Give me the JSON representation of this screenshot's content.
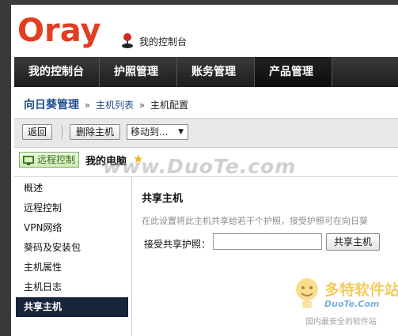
{
  "brand": {
    "logo_text": "Oray",
    "console_link": "我的控制台"
  },
  "nav": {
    "tabs": [
      {
        "label": "我的控制台"
      },
      {
        "label": "护照管理"
      },
      {
        "label": "账务管理"
      },
      {
        "label": "产品管理"
      }
    ],
    "active_index": 3
  },
  "breadcrumb": {
    "root": "向日葵管理",
    "separator": "»",
    "items": [
      "主机列表",
      "主机配置"
    ]
  },
  "toolbar": {
    "back_label": "返回",
    "delete_label": "删除主机",
    "move_select_value": "移动到..."
  },
  "device": {
    "remote_label": "远程控制",
    "name": "我的电脑"
  },
  "sidebar": {
    "items": [
      {
        "label": "概述"
      },
      {
        "label": "远程控制"
      },
      {
        "label": "VPN网络"
      },
      {
        "label": "葵码及安装包"
      },
      {
        "label": "主机属性"
      },
      {
        "label": "主机日志"
      },
      {
        "label": "共享主机"
      }
    ],
    "active_index": 6
  },
  "panel": {
    "title": "共享主机",
    "description": "在此设置将此主机共享给若干个护照，接受护照可在向日葵",
    "accept_label": "接受共享护照：",
    "accept_value": "",
    "share_button": "共享主机"
  },
  "watermark": {
    "domain": "www.DuoTe.com",
    "logo_title": "多特软件站",
    "logo_sub": "DuoTe.Com",
    "logo_tagline": "国内最安全的软件站"
  },
  "colors": {
    "nav_bg": "#2a2a2a",
    "active_side": "#17243a",
    "link": "#1d4c8a",
    "logo_red": "#e23e1f"
  }
}
